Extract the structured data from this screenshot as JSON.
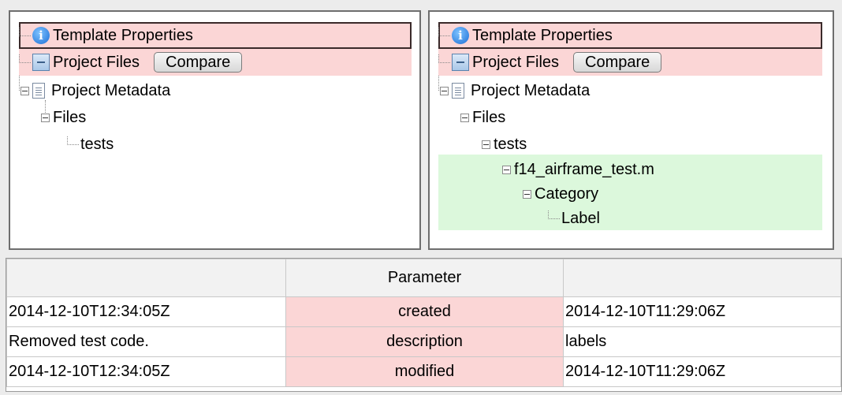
{
  "left_tree": {
    "template_properties": "Template Properties",
    "project_files": "Project Files",
    "compare": "Compare",
    "project_metadata": "Project Metadata",
    "files": "Files",
    "tests": "tests"
  },
  "right_tree": {
    "template_properties": "Template Properties",
    "project_files": "Project Files",
    "compare": "Compare",
    "project_metadata": "Project Metadata",
    "files": "Files",
    "tests": "tests",
    "test_file": "f14_airframe_test.m",
    "category": "Category",
    "label": "Label"
  },
  "table": {
    "headers": [
      "",
      "Parameter",
      ""
    ],
    "rows": [
      {
        "left": "2014-12-10T12:34:05Z",
        "param": "created",
        "right": "2014-12-10T11:29:06Z"
      },
      {
        "left": "Removed test code.",
        "param": "description",
        "right": "labels"
      },
      {
        "left": "2014-12-10T12:34:05Z",
        "param": "modified",
        "right": "2014-12-10T11:29:06Z"
      }
    ]
  },
  "colors": {
    "removed_highlight": "#fbd6d6",
    "added_highlight": "#dcf8dc",
    "info_icon": "#1b6fd6"
  },
  "icons": [
    "info-icon",
    "project-files-icon",
    "document-icon",
    "collapse-icon"
  ]
}
